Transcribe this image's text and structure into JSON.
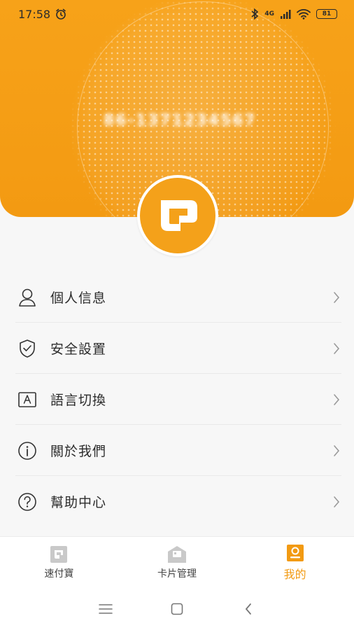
{
  "status_bar": {
    "time": "17:58",
    "network": "4G",
    "battery": "81"
  },
  "profile": {
    "account_id": "86-13712345678"
  },
  "menu": {
    "items": [
      {
        "label": "個人信息",
        "icon": "user-icon"
      },
      {
        "label": "安全設置",
        "icon": "shield-check-icon"
      },
      {
        "label": "語言切換",
        "icon": "language-icon"
      },
      {
        "label": "關於我們",
        "icon": "info-icon"
      },
      {
        "label": "幫助中心",
        "icon": "help-icon"
      }
    ]
  },
  "bottom_nav": {
    "items": [
      {
        "label": "速付寶",
        "icon": "wallet-app-icon",
        "active": false
      },
      {
        "label": "卡片管理",
        "icon": "card-management-icon",
        "active": false
      },
      {
        "label": "我的",
        "icon": "profile-card-icon",
        "active": true
      }
    ]
  },
  "colors": {
    "brand": "#f39a12",
    "text": "#2c2c2c",
    "divider": "#e9e9e9"
  }
}
